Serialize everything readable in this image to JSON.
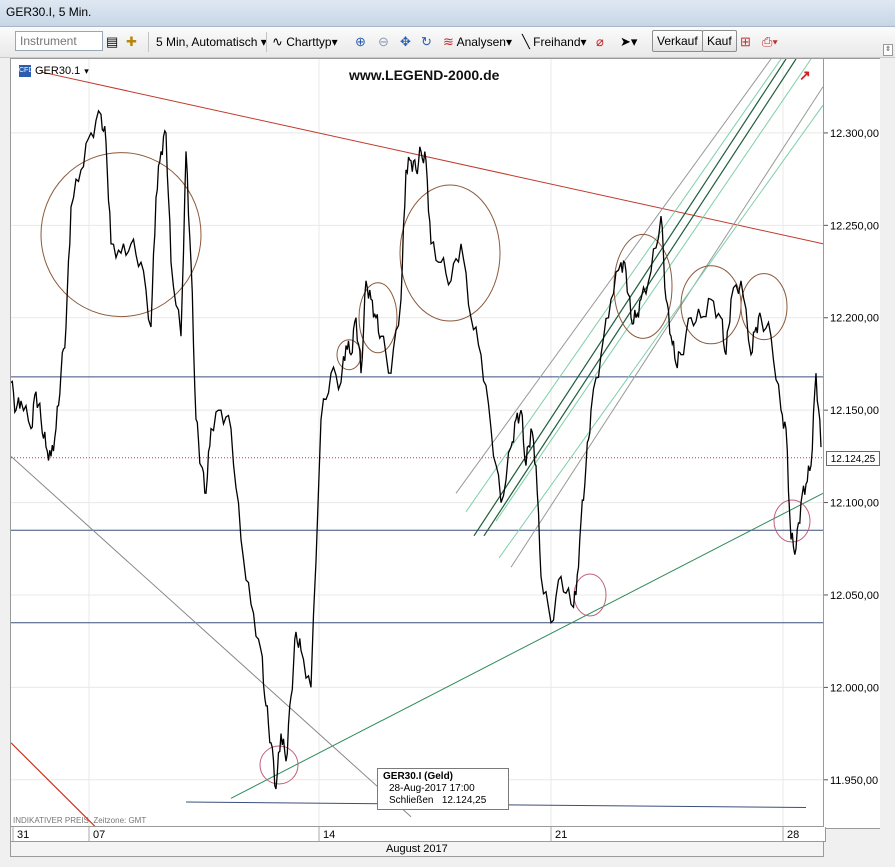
{
  "window": {
    "title": "GER30.I, 5 Min."
  },
  "toolbar": {
    "instrument_placeholder": "Instrument",
    "timeframe_label": "5 Min,",
    "mode_label": "Automatisch",
    "charttype_label": "Charttyp",
    "analysen_label": "Analysen",
    "freihand_label": "Freihand",
    "sell_label": "Verkauf",
    "buy_label": "Kauf"
  },
  "chart": {
    "symbol_label": "GER30.1",
    "watermark": "www.LEGEND-2000.de",
    "last_price_label": "12.124,25",
    "indicator_label": "INDIKATIVER PREIS",
    "timezone_label": "Zeitzone: GMT",
    "month_label": "August 2017",
    "tooltip": {
      "title": "GER30.I (Geld)",
      "time": "28-Aug-2017 17:00",
      "close_label": "Schließen",
      "close_value": "12.124,25"
    },
    "colors": {
      "price": "#000000",
      "resistance": "#c0392b",
      "support": "#2e8b57",
      "horizontal": "#3b4f7a",
      "channel": "#1e5e3a",
      "channel_light": "#7fcfa8",
      "ellipse": "#8b5a3c",
      "ellipse_pink": "#c0607a"
    }
  },
  "chart_data": {
    "type": "line",
    "y_ticks": [
      "12.300,00",
      "12.250,00",
      "12.200,00",
      "12.150,00",
      "12.100,00",
      "12.050,00",
      "12.000,00",
      "11.950,00"
    ],
    "x_ticks": [
      "31",
      "07",
      "14",
      "21",
      "28"
    ],
    "ylim": [
      11925,
      12340
    ],
    "x": [
      0,
      5,
      10,
      20,
      25,
      30,
      35,
      40,
      45,
      50,
      55,
      60,
      70,
      80,
      90,
      95,
      100,
      110,
      120,
      130,
      140,
      145,
      150,
      155,
      160,
      170,
      175,
      180,
      185,
      190,
      195,
      200,
      210,
      220,
      230,
      240,
      250,
      255,
      260,
      265,
      270,
      275,
      280,
      285,
      290,
      300,
      310,
      320,
      330,
      335,
      340,
      345,
      350,
      355,
      360,
      365,
      370,
      380,
      390,
      395,
      400,
      405,
      410,
      415,
      420,
      430,
      440,
      450,
      460,
      470,
      480,
      490,
      500,
      505,
      510,
      515,
      520,
      525,
      530,
      540,
      550,
      560,
      565,
      570,
      575,
      580,
      590,
      600,
      610,
      615,
      620,
      625,
      630,
      640,
      650,
      655,
      660,
      665,
      670,
      680,
      690,
      700,
      710,
      715,
      720,
      730,
      740,
      745,
      750,
      760,
      770,
      775,
      780,
      785,
      790,
      795,
      800,
      805,
      810
    ],
    "y": [
      12165,
      12150,
      12155,
      12140,
      12160,
      12145,
      12130,
      12125,
      12140,
      12170,
      12195,
      12260,
      12280,
      12300,
      12310,
      12295,
      12240,
      12235,
      12240,
      12230,
      12195,
      12265,
      12290,
      12300,
      12230,
      12190,
      12290,
      12230,
      12145,
      12120,
      12105,
      12140,
      12150,
      12140,
      12080,
      12045,
      12020,
      11990,
      11970,
      11945,
      11975,
      11960,
      11995,
      12030,
      12020,
      12000,
      12145,
      12170,
      12165,
      12185,
      12180,
      12200,
      12170,
      12220,
      12210,
      12200,
      12190,
      12170,
      12210,
      12280,
      12285,
      12280,
      12290,
      12285,
      12240,
      12230,
      12220,
      12240,
      12200,
      12180,
      12140,
      12100,
      12130,
      12145,
      12150,
      12120,
      12140,
      12120,
      12060,
      12035,
      12060,
      12045,
      12050,
      12090,
      12120,
      12150,
      12180,
      12210,
      12230,
      12225,
      12200,
      12200,
      12210,
      12225,
      12255,
      12210,
      12190,
      12175,
      12180,
      12200,
      12200,
      12210,
      12200,
      12180,
      12210,
      12220,
      12180,
      12195,
      12200,
      12190,
      12150,
      12140,
      12080,
      12075,
      12100,
      12110,
      12120,
      12170,
      12130
    ]
  }
}
